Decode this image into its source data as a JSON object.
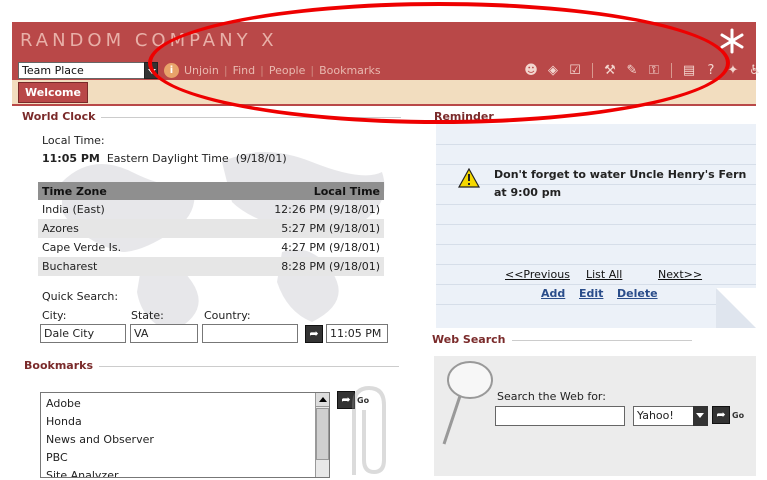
{
  "brand": {
    "logo_text": "RANDOM COMPANY X",
    "bar_color": "#b94848"
  },
  "toolbar": {
    "team_select": "Team Place",
    "links": [
      "Unjoin",
      "Find",
      "People",
      "Bookmarks"
    ],
    "icons": [
      "people-group-icon",
      "cube-icon",
      "checkbox-icon",
      "tools-icon",
      "edit-icon",
      "lock-icon",
      "inbox-icon",
      "help-icon",
      "star-icon",
      "accessibility-icon"
    ]
  },
  "tabs": [
    {
      "label": "Welcome",
      "active": true
    }
  ],
  "world_clock": {
    "title": "World Clock",
    "local_time_label": "Local Time:",
    "local_time": "11:05 PM",
    "local_zone": "Eastern Daylight Time",
    "local_date": "(9/18/01)",
    "columns": [
      "Time Zone",
      "Local Time"
    ],
    "rows": [
      {
        "zone": "India (East)",
        "time": "12:26 PM (9/18/01)"
      },
      {
        "zone": "Azores",
        "time": "5:27 PM (9/18/01)"
      },
      {
        "zone": "Cape Verde Is.",
        "time": "4:27 PM (9/18/01)"
      },
      {
        "zone": "Bucharest",
        "time": "8:28 PM (9/18/01)"
      }
    ],
    "quick_search_label": "Quick Search:",
    "city_label": "City:",
    "state_label": "State:",
    "country_label": "Country:",
    "city_value": "Dale City",
    "state_value": "VA",
    "country_value": "",
    "result_time": "11:05 PM"
  },
  "bookmarks": {
    "title": "Bookmarks",
    "items": [
      "Adobe",
      "Honda",
      "News and Observer",
      "PBC",
      "Site Analyzer"
    ],
    "go_label": "Go"
  },
  "reminder": {
    "title": "Reminder",
    "message": "Don't forget to water Uncle Henry's Fern at 9:00 pm",
    "prev": "<<Previous",
    "list_all": "List All",
    "next": "Next>>",
    "add": "Add",
    "edit": "Edit",
    "delete": "Delete"
  },
  "web_search": {
    "title": "Web Search",
    "label": "Search the Web for:",
    "query": "",
    "engine": "Yahoo!",
    "go_label": "Go"
  },
  "annotation": {
    "color": "#ee0000"
  }
}
